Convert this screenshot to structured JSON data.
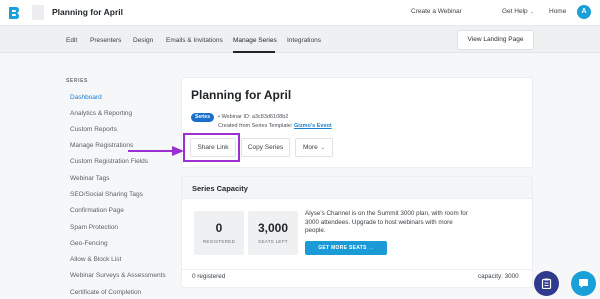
{
  "header": {
    "title": "Planning for April",
    "create_webinar": "Create a Webinar",
    "get_help": "Get Help",
    "home": "Home",
    "avatar_initial": "A"
  },
  "tabs": {
    "items": [
      "Edit",
      "Presenters",
      "Design",
      "Emails & Invitations",
      "Manage Series",
      "Integrations"
    ],
    "active": "Manage Series",
    "view_landing_page": "View Landing Page"
  },
  "sidebar": {
    "heading": "SERIES",
    "active": "Dashboard",
    "items": [
      "Dashboard",
      "Analytics & Reporting",
      "Custom Reports",
      "Manage Registrations",
      "Custom Registration Fields",
      "Webinar Tags",
      "SEO/Social Sharing Tags",
      "Confirmation Page",
      "Spam Protection",
      "Geo-Fencing",
      "Allow & Block List",
      "Webinar Surveys & Assessments",
      "Certificate of Completion"
    ]
  },
  "main": {
    "title": "Planning for April",
    "series_badge": "Series",
    "webinar_id": "• Webinar ID: a3c83d6108b2",
    "created_from_prefix": "Created from Series Template:",
    "template_name": "Gizmo's Event",
    "share_link": "Share Link",
    "copy_series": "Copy Series",
    "more": "More"
  },
  "capacity": {
    "title": "Series Capacity",
    "registered_count": "0",
    "registered_label": "REGISTERED",
    "seats_left_count": "3,000",
    "seats_left_label": "SEATS LEFT",
    "description": "Alyse's Channel is on the Summit 3000 plan, with room for 3000 attendees. Upgrade to host webinars with more people.",
    "get_more_seats": "GET MORE SEATS →",
    "registered_footer": "0 registered",
    "capacity_footer": "capacity: 3000"
  },
  "colors": {
    "accent": "#1d7fd1",
    "series_badge": "#1b6ec9",
    "highlight": "#9b2fd0",
    "cta": "#1b9bd6",
    "fab_dark": "#2f3a8c",
    "fab_blue": "#1aa0d8"
  },
  "icons": {
    "logo": "brand-logo-icon",
    "fab_left": "clipboard-icon",
    "fab_right": "chat-bubble-icon"
  }
}
